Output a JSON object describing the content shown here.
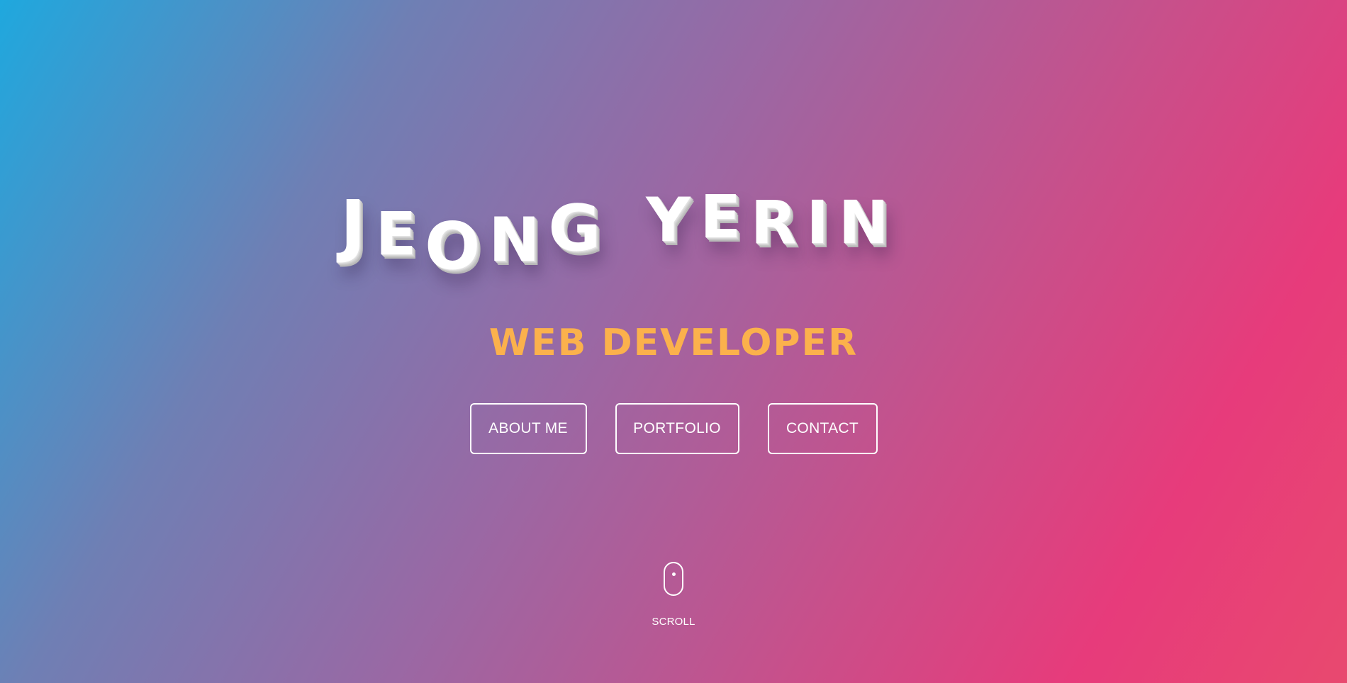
{
  "hero": {
    "name_letters": [
      "J",
      "E",
      "O",
      "N",
      "G",
      "Y",
      "E",
      "R",
      "I",
      "N"
    ],
    "subtitle": "WEB DEVELOPER"
  },
  "nav": {
    "about_label": "ABOUT ME",
    "portfolio_label": "PORTFOLIO",
    "contact_label": "CONTACT"
  },
  "scroll": {
    "label": "SCROLL",
    "icon": "mouse-icon"
  },
  "colors": {
    "gradient_start": "#1fa8de",
    "gradient_mid": "#9a68a4",
    "gradient_end": "#e73b7b",
    "subtitle": "#fbb14c",
    "text": "#ffffff"
  }
}
